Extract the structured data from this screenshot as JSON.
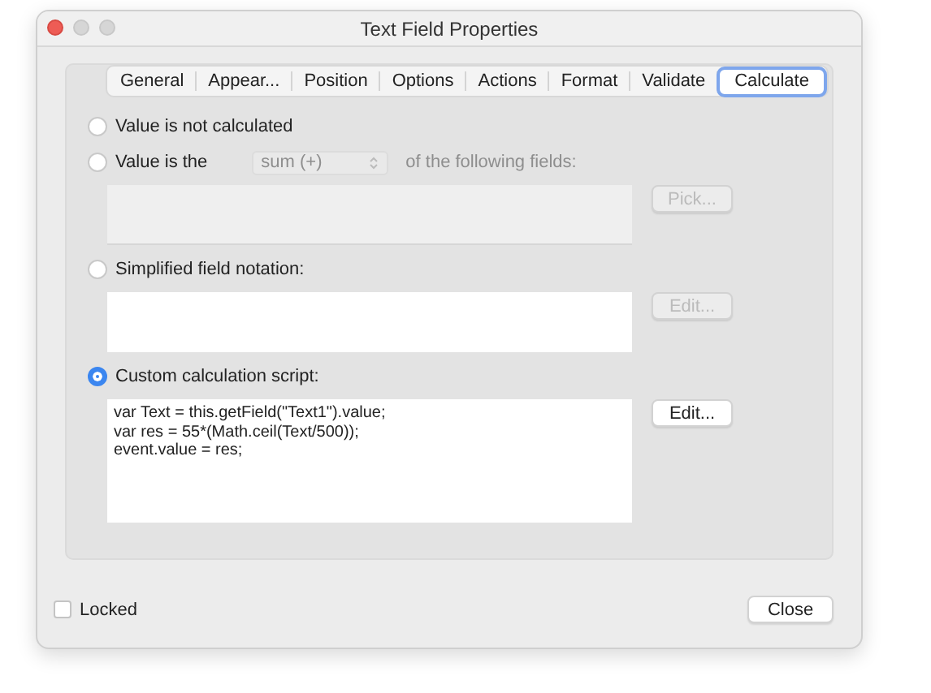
{
  "window": {
    "title": "Text Field Properties"
  },
  "tabs": [
    {
      "label": "General",
      "selected": false
    },
    {
      "label": "Appear...",
      "selected": false
    },
    {
      "label": "Position",
      "selected": false
    },
    {
      "label": "Options",
      "selected": false
    },
    {
      "label": "Actions",
      "selected": false
    },
    {
      "label": "Format",
      "selected": false
    },
    {
      "label": "Validate",
      "selected": false
    },
    {
      "label": "Calculate",
      "selected": true
    }
  ],
  "calculation_options": [
    {
      "kind": "none",
      "label": "Value is not calculated",
      "selected": false
    },
    {
      "kind": "fields",
      "label": "Value is the",
      "selected": false,
      "operator": "sum (+)",
      "suffix": "of the following fields:",
      "button": {
        "label": "Pick...",
        "disabled": true
      }
    },
    {
      "kind": "simplified",
      "label": "Simplified field notation:",
      "selected": false,
      "button": {
        "label": "Edit...",
        "disabled": true
      }
    },
    {
      "kind": "custom",
      "label": "Custom calculation script:",
      "selected": true,
      "script": [
        "var Text = this.getField(\"Text1\").value;",
        "var res = 55*(Math.ceil(Text/500));",
        "event.value = res;"
      ],
      "button": {
        "label": "Edit...",
        "disabled": false
      }
    }
  ],
  "locked": {
    "label": "Locked",
    "checked": false
  },
  "close_button": "Close"
}
